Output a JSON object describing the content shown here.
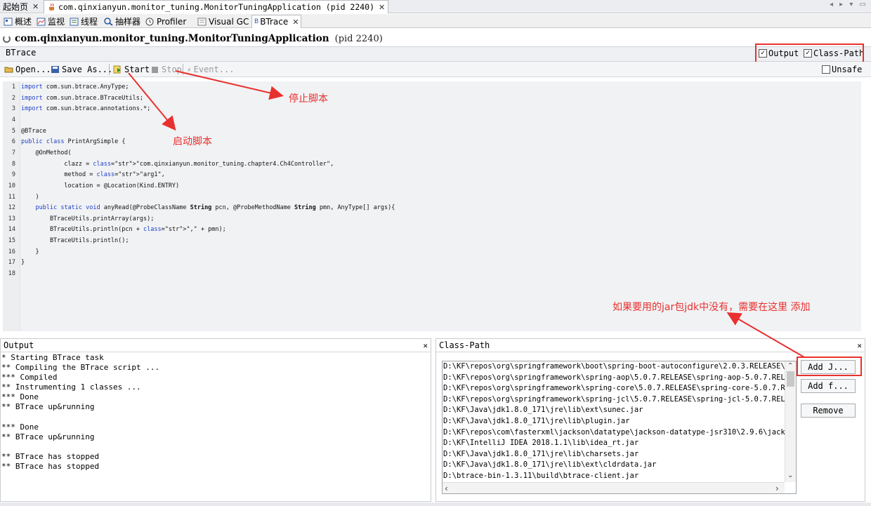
{
  "doc_tabs": [
    {
      "label": "起始页"
    },
    {
      "label": "com.qinxianyun.monitor_tuning.MonitorTuningApplication (pid 2240)"
    }
  ],
  "view_tabs": [
    {
      "label": "概述"
    },
    {
      "label": "监视"
    },
    {
      "label": "线程"
    },
    {
      "label": "抽样器"
    },
    {
      "label": "Profiler"
    },
    {
      "label": "Visual GC"
    },
    {
      "label": "BTrace"
    }
  ],
  "header": {
    "title": "com.qinxianyun.monitor_tuning.MonitorTuningApplication",
    "pid": "(pid 2240)"
  },
  "btrace_bar": {
    "label": "BTrace",
    "output_checkbox": "Output",
    "classpath_checkbox": "Class-Path"
  },
  "toolbar": {
    "open": "Open...",
    "save_as": "Save As...",
    "start": "Start",
    "stop": "Stop",
    "event": "Event...",
    "unsafe": "Unsafe"
  },
  "editor": {
    "lines": [
      "import com.sun.btrace.AnyType;",
      "import com.sun.btrace.BTraceUtils;",
      "import com.sun.btrace.annotations.*;",
      "",
      "@BTrace",
      "public class PrintArgSimple {",
      "    @OnMethod(",
      "            clazz = \"com.qinxianyun.monitor_tuning.chapter4.Ch4Controller\",",
      "            method = \"arg1\",",
      "            location = @Location(Kind.ENTRY)",
      "    )",
      "    public static void anyRead(@ProbeClassName String pcn, @ProbeMethodName String pmn, AnyType[] args){",
      "        BTraceUtils.printArray(args);",
      "        BTraceUtils.println(pcn + \",\" + pmn);",
      "        BTraceUtils.println();",
      "    }",
      "}",
      ""
    ],
    "line_numbers": [
      "1",
      "2",
      "3",
      "4",
      "5",
      "6",
      "7",
      "8",
      "9",
      "10",
      "11",
      "12",
      "13",
      "14",
      "15",
      "16",
      "17",
      "18"
    ]
  },
  "output": {
    "title": "Output",
    "lines": [
      "* Starting BTrace task",
      "** Compiling the BTrace script ...",
      "*** Compiled",
      "** Instrumenting 1 classes ...",
      "*** Done",
      "** BTrace up&running",
      "",
      "*** Done",
      "** BTrace up&running",
      "",
      "** BTrace has stopped",
      "** BTrace has stopped"
    ]
  },
  "classpath": {
    "title": "Class-Path",
    "entries": [
      "D:\\KF\\repos\\org\\springframework\\boot\\spring-boot-autoconfigure\\2.0.3.RELEASE\\",
      "D:\\KF\\repos\\org\\springframework\\spring-aop\\5.0.7.RELEASE\\spring-aop-5.0.7.REL",
      "D:\\KF\\repos\\org\\springframework\\spring-core\\5.0.7.RELEASE\\spring-core-5.0.7.R",
      "D:\\KF\\repos\\org\\springframework\\spring-jcl\\5.0.7.RELEASE\\spring-jcl-5.0.7.REL",
      "D:\\KF\\Java\\jdk1.8.0_171\\jre\\lib\\ext\\sunec.jar",
      "D:\\KF\\Java\\jdk1.8.0_171\\jre\\lib\\plugin.jar",
      "D:\\KF\\repos\\com\\fasterxml\\jackson\\datatype\\jackson-datatype-jsr310\\2.9.6\\jack",
      "D:\\KF\\IntelliJ IDEA 2018.1.1\\lib\\idea_rt.jar",
      "D:\\KF\\Java\\jdk1.8.0_171\\jre\\lib\\charsets.jar",
      "D:\\KF\\Java\\jdk1.8.0_171\\jre\\lib\\ext\\cldrdata.jar",
      "D:\\btrace-bin-1.3.11\\build\\btrace-client.jar"
    ],
    "add_jar": "Add J...",
    "add_folder": "Add f...",
    "remove": "Remove"
  },
  "annotations": {
    "stop_script": "停止脚本",
    "start_script": "启动脚本",
    "classpath_note": "如果要用的jar包jdk中没有，需要在这里 添加"
  },
  "colors": {
    "annotation_red": "#e8312f",
    "keyword_blue": "#1c3fc6",
    "string_orange": "#c77a1a"
  }
}
